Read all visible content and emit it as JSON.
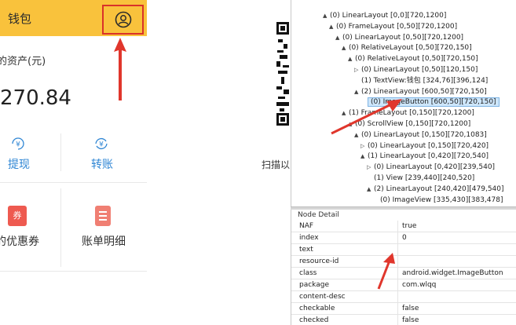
{
  "phone": {
    "title": "钱包",
    "assets_label": "的资产(元)",
    "assets_value": "270.84",
    "actions": [
      {
        "label": "提现",
        "icon": "yuan-withdraw-icon"
      },
      {
        "label": "转账",
        "icon": "yuan-transfer-icon"
      }
    ],
    "tiles": [
      {
        "label": "的优惠券",
        "icon_text": "券"
      },
      {
        "label": "账单明细",
        "icon": "bill-icon"
      }
    ]
  },
  "middle": {
    "scan_text": "扫描以"
  },
  "tree": [
    {
      "indent": 2,
      "toggle": "▲",
      "text": "(0) LinearLayout [0,0][720,1200]"
    },
    {
      "indent": 3,
      "toggle": "▲",
      "text": "(0) FrameLayout [0,50][720,1200]"
    },
    {
      "indent": 4,
      "toggle": "▲",
      "text": "(0) LinearLayout [0,50][720,1200]"
    },
    {
      "indent": 5,
      "toggle": "▲",
      "text": "(0) RelativeLayout [0,50][720,150]"
    },
    {
      "indent": 6,
      "toggle": "▲",
      "text": "(0) RelativeLayout [0,50][720,150]"
    },
    {
      "indent": 7,
      "toggle": "▷",
      "text": "(0) LinearLayout [0,50][120,150]"
    },
    {
      "indent": 7,
      "toggle": "",
      "text": "(1) TextView:钱包 [324,76][396,124]"
    },
    {
      "indent": 7,
      "toggle": "▲",
      "text": "(2) LinearLayout [600,50][720,150]"
    },
    {
      "indent": 8,
      "toggle": "",
      "text": "(0) ImageButton [600,50][720,150]",
      "selected": true
    },
    {
      "indent": 5,
      "toggle": "▲",
      "text": "(1) FrameLayout [0,150][720,1200]"
    },
    {
      "indent": 6,
      "toggle": "▲",
      "text": "(0) ScrollView [0,150][720,1200]"
    },
    {
      "indent": 7,
      "toggle": "▲",
      "text": "(0) LinearLayout [0,150][720,1083]"
    },
    {
      "indent": 8,
      "toggle": "▷",
      "text": "(0) LinearLayout [0,150][720,420]"
    },
    {
      "indent": 8,
      "toggle": "▲",
      "text": "(1) LinearLayout [0,420][720,540]"
    },
    {
      "indent": 9,
      "toggle": "▷",
      "text": "(0) LinearLayout [0,420][239,540]"
    },
    {
      "indent": 9,
      "toggle": "",
      "text": "(1) View [239,440][240,520]"
    },
    {
      "indent": 9,
      "toggle": "▲",
      "text": "(2) LinearLayout [240,420][479,540]"
    },
    {
      "indent": 10,
      "toggle": "",
      "text": "(0) ImageView [335,430][383,478]"
    }
  ],
  "detail": {
    "title": "Node Detail",
    "rows": [
      {
        "key": "NAF",
        "value": "true"
      },
      {
        "key": "index",
        "value": "0"
      },
      {
        "key": "text",
        "value": ""
      },
      {
        "key": "resource-id",
        "value": ""
      },
      {
        "key": "class",
        "value": "android.widget.ImageButton"
      },
      {
        "key": "package",
        "value": "com.wlqq"
      },
      {
        "key": "content-desc",
        "value": ""
      },
      {
        "key": "checkable",
        "value": "false"
      },
      {
        "key": "checked",
        "value": "false"
      }
    ]
  },
  "colors": {
    "header_yellow": "#f9c23c",
    "highlight_red": "#d9322a",
    "action_blue": "#2f86d4",
    "tree_selection": "#cde6fb"
  }
}
